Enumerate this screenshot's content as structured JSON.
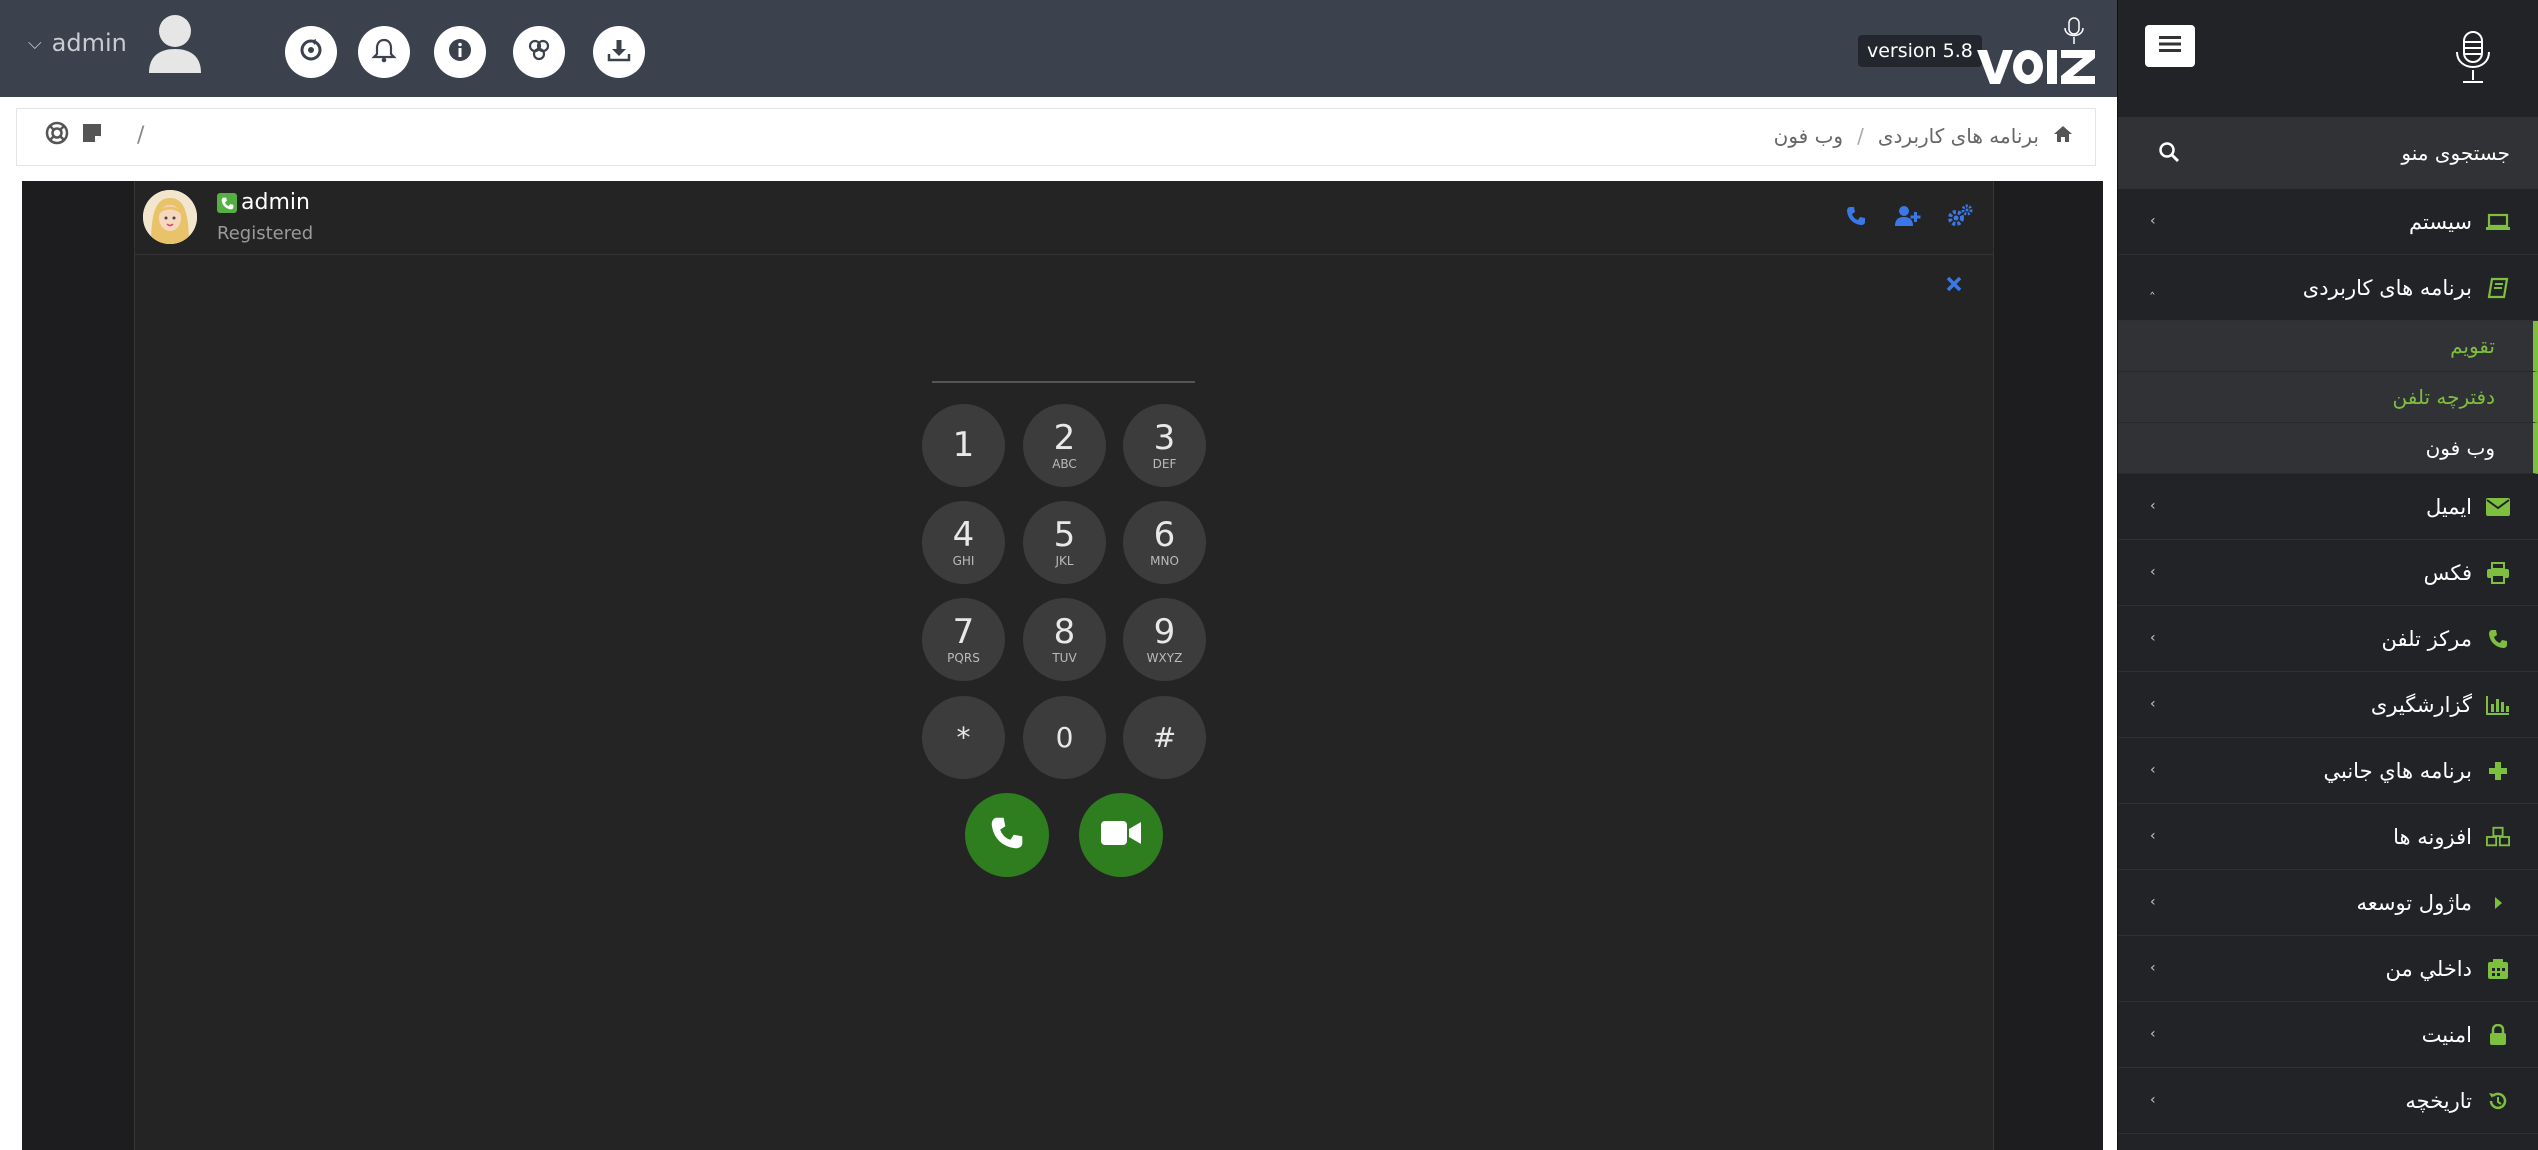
{
  "topbar": {
    "user_name": "admin",
    "version": "version 5.8",
    "buttons": [
      "refresh-icon",
      "bell-icon",
      "info-icon",
      "dashboard-icon",
      "download-icon"
    ]
  },
  "sidebar": {
    "search_placeholder": "جستجوی منو",
    "items": [
      {
        "label": "سیستم",
        "icon": "laptop-icon"
      },
      {
        "label": "برنامه های کاربردی",
        "icon": "book-icon",
        "expanded": true
      },
      {
        "label": "ایمیل",
        "icon": "envelope-icon"
      },
      {
        "label": "فکس",
        "icon": "printer-icon"
      },
      {
        "label": "مرکز تلفن",
        "icon": "phone-icon"
      },
      {
        "label": "گزارشگیری",
        "icon": "bar-chart-icon"
      },
      {
        "label": "برنامه هاي جانبي",
        "icon": "plus-icon"
      },
      {
        "label": "افزونه ها",
        "icon": "cubes-icon"
      },
      {
        "label": "ماژول توسعه",
        "icon": "caret-right-icon"
      },
      {
        "label": "داخلي من",
        "icon": "fax-icon"
      },
      {
        "label": "امنیت",
        "icon": "lock-icon"
      },
      {
        "label": "تاریخچه",
        "icon": "history-icon"
      }
    ],
    "subitems": [
      {
        "label": "تقویم",
        "color": "#7fbf3f"
      },
      {
        "label": "دفترچه تلفن",
        "color": "#7fbf3f"
      },
      {
        "label": "وب فون",
        "color": "#ffffff"
      }
    ]
  },
  "breadcrumb": {
    "sep_left": "/",
    "items": [
      "برنامه های کاربردی",
      "وب فون"
    ]
  },
  "webphone": {
    "user": "admin",
    "status": "Registered",
    "keys": [
      {
        "d": "1",
        "s": ""
      },
      {
        "d": "2",
        "s": "ABC"
      },
      {
        "d": "3",
        "s": "DEF"
      },
      {
        "d": "4",
        "s": "GHI"
      },
      {
        "d": "5",
        "s": "JKL"
      },
      {
        "d": "6",
        "s": "MNO"
      },
      {
        "d": "7",
        "s": "PQRS"
      },
      {
        "d": "8",
        "s": "TUV"
      },
      {
        "d": "9",
        "s": "WXYZ"
      },
      {
        "d": "*",
        "s": ""
      },
      {
        "d": "0",
        "s": ""
      },
      {
        "d": "#",
        "s": ""
      }
    ]
  },
  "colors": {
    "accent_green": "#7fbf3f",
    "action_blue": "#3a78e8",
    "call_green": "#2e7d1f"
  }
}
